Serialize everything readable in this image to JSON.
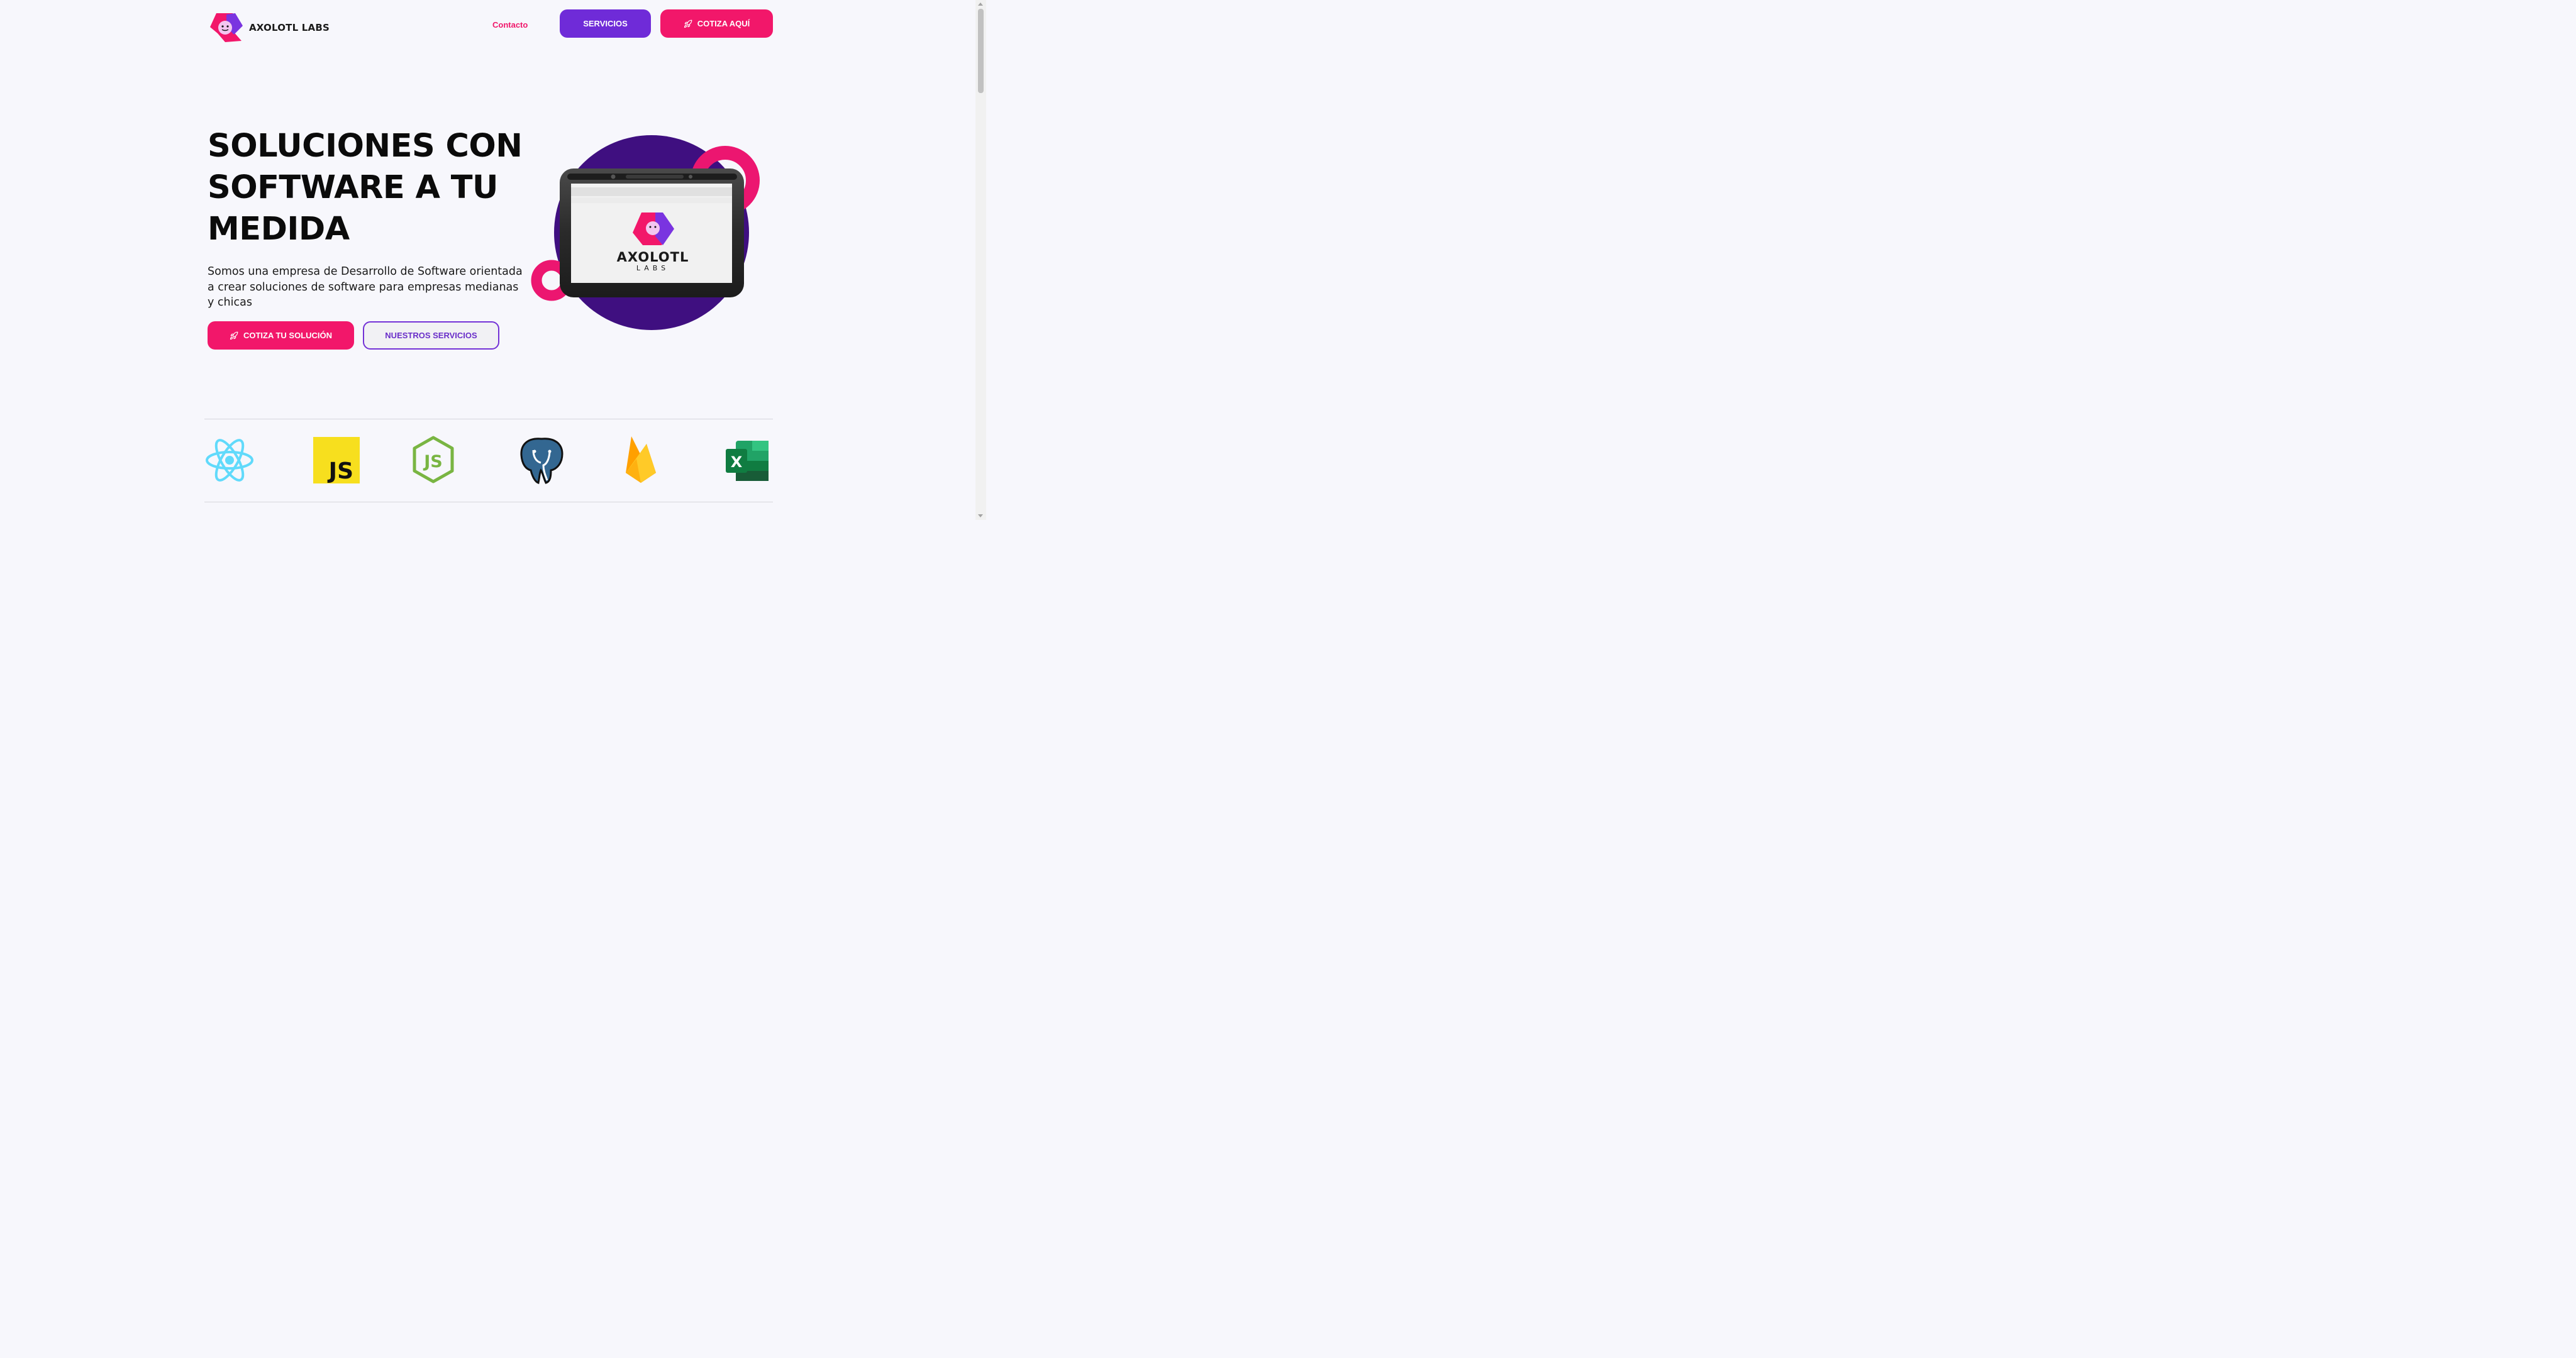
{
  "header": {
    "brand_name": "AXOLOTL LABS",
    "nav_contacto": "Contacto",
    "btn_servicios": "SERVICIOS",
    "btn_cotiza": "COTIZA AQUÍ"
  },
  "hero": {
    "title": "SOLUCIONES CON SOFTWARE A TU MEDIDA",
    "description": "Somos una empresa de Desarrollo de Software orientada a crear soluciones de software para empresas medianas y chicas",
    "btn_primary": "COTIZA TU SOLUCIÓN",
    "btn_secondary": "NUESTROS SERVICIOS"
  },
  "illustration": {
    "screen_brand_main": "AXOLOTL",
    "screen_brand_sub": "LABS"
  },
  "tech_logos": [
    {
      "name": "react-icon",
      "label": ""
    },
    {
      "name": "javascript-icon",
      "label": "JS"
    },
    {
      "name": "nodejs-icon",
      "label": "JS"
    },
    {
      "name": "postgresql-icon",
      "label": ""
    },
    {
      "name": "firebase-icon",
      "label": ""
    },
    {
      "name": "excel-icon",
      "label": "X"
    }
  ],
  "colors": {
    "accent_pink": "#f2176a",
    "accent_purple": "#6f2bd8",
    "background": "#f7f7fc"
  }
}
